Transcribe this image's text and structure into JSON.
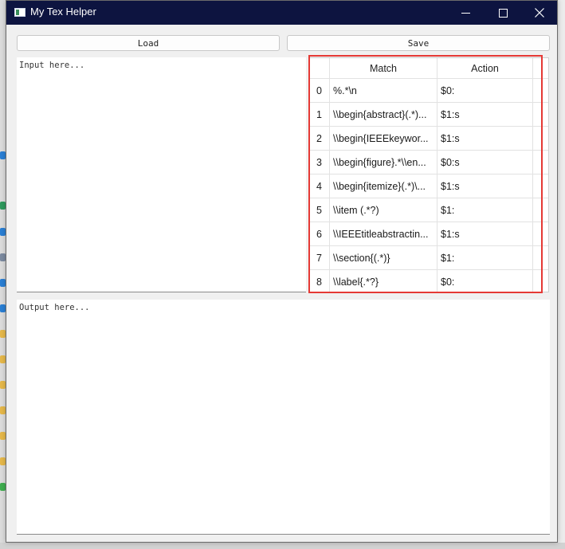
{
  "window": {
    "title": "My Tex Helper",
    "controls": [
      "minimize-icon",
      "maximize-icon",
      "close-icon"
    ]
  },
  "toolbar": {
    "load_label": "Load",
    "save_label": "Save"
  },
  "input": {
    "placeholder": "Input here..."
  },
  "output": {
    "placeholder": "Output here..."
  },
  "table": {
    "headers": {
      "match": "Match",
      "action": "Action"
    },
    "rows": [
      {
        "index": "0",
        "match": "%.*\\n",
        "action": "$0:"
      },
      {
        "index": "1",
        "match": "\\\\begin{abstract}(.*)...",
        "action": "$1:s"
      },
      {
        "index": "2",
        "match": "\\\\begin{IEEEkeywor...",
        "action": "$1:s"
      },
      {
        "index": "3",
        "match": "\\\\begin{figure}.*\\\\en...",
        "action": "$0:s"
      },
      {
        "index": "4",
        "match": "\\\\begin{itemize}(.*)\\...",
        "action": "$1:s"
      },
      {
        "index": "5",
        "match": "\\\\item (.*?)",
        "action": "$1:"
      },
      {
        "index": "6",
        "match": "\\\\IEEEtitleabstractin...",
        "action": "$1:s"
      },
      {
        "index": "7",
        "match": "\\\\section{(.*)}",
        "action": "$1:"
      },
      {
        "index": "8",
        "match": "\\\\label{.*?}",
        "action": "$0:"
      }
    ]
  },
  "colors": {
    "titlebar": "#0d1440",
    "highlight": "#e53935"
  }
}
